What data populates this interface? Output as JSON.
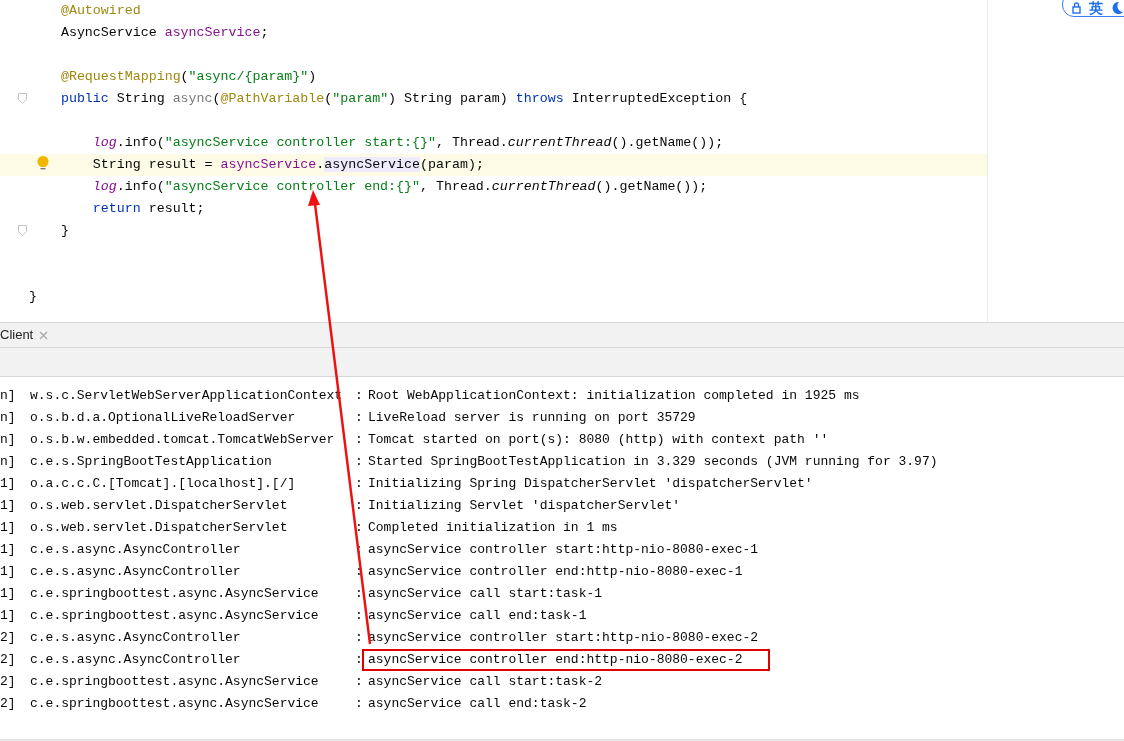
{
  "editor": {
    "lines": [
      {
        "kind": "code",
        "tokens": [
          {
            "text": "    @Autowired",
            "kind": "annotation"
          }
        ]
      },
      {
        "kind": "code",
        "tokens": [
          {
            "text": "    AsyncService ",
            "kind": "plain"
          },
          {
            "text": "asyncService",
            "kind": "field"
          },
          {
            "text": ";",
            "kind": "plain"
          }
        ]
      },
      {
        "kind": "blank"
      },
      {
        "kind": "code",
        "tokens": [
          {
            "text": "    @RequestMapping",
            "kind": "annotation"
          },
          {
            "text": "(",
            "kind": "plain"
          },
          {
            "text": "\"async/{param}\"",
            "kind": "string"
          },
          {
            "text": ")",
            "kind": "plain"
          }
        ]
      },
      {
        "kind": "code",
        "fold_marker": true,
        "tokens": [
          {
            "text": "    public",
            "kind": "keyword"
          },
          {
            "text": " String ",
            "kind": "plain"
          },
          {
            "text": "async",
            "kind": "unused"
          },
          {
            "text": "(",
            "kind": "plain"
          },
          {
            "text": "@PathVariable",
            "kind": "annotation"
          },
          {
            "text": "(",
            "kind": "plain"
          },
          {
            "text": "\"param\"",
            "kind": "string"
          },
          {
            "text": ") String param) ",
            "kind": "plain"
          },
          {
            "text": "throws",
            "kind": "keyword"
          },
          {
            "text": " InterruptedException {",
            "kind": "plain"
          }
        ]
      },
      {
        "kind": "blank"
      },
      {
        "kind": "code",
        "tokens": [
          {
            "text": "        log",
            "kind": "static-field"
          },
          {
            "text": ".info(",
            "kind": "plain"
          },
          {
            "text": "\"asyncService controller start:{}\"",
            "kind": "string"
          },
          {
            "text": ", Thread.",
            "kind": "plain"
          },
          {
            "text": "currentThread",
            "kind": "static-call"
          },
          {
            "text": "().getName());",
            "kind": "plain"
          }
        ]
      },
      {
        "kind": "code",
        "current": true,
        "intention_bulb": true,
        "tokens": [
          {
            "text": "        String result = ",
            "kind": "plain"
          },
          {
            "text": "asyncService",
            "kind": "field"
          },
          {
            "text": ".",
            "kind": "plain"
          },
          {
            "text": "asyncService",
            "kind": "usage"
          },
          {
            "text": "(param);",
            "kind": "plain"
          }
        ]
      },
      {
        "kind": "code",
        "tokens": [
          {
            "text": "        log",
            "kind": "static-field"
          },
          {
            "text": ".info(",
            "kind": "plain"
          },
          {
            "text": "\"asyncService controller end:{}\"",
            "kind": "string"
          },
          {
            "text": ", Thread.",
            "kind": "plain"
          },
          {
            "text": "currentThread",
            "kind": "static-call"
          },
          {
            "text": "().getName());",
            "kind": "plain"
          }
        ]
      },
      {
        "kind": "code",
        "tokens": [
          {
            "text": "        return",
            "kind": "keyword"
          },
          {
            "text": " result;",
            "kind": "plain"
          }
        ]
      },
      {
        "kind": "code",
        "fold_marker": true,
        "tokens": [
          {
            "text": "    }",
            "kind": "plain"
          }
        ]
      },
      {
        "kind": "blank"
      },
      {
        "kind": "blank"
      },
      {
        "kind": "code",
        "tokens": [
          {
            "text": "}",
            "kind": "plain"
          }
        ]
      }
    ]
  },
  "ime_indicator": {
    "label": "英"
  },
  "console": {
    "tabs": [
      {
        "label": "Client"
      }
    ],
    "lines": [
      {
        "thread": "n]",
        "logger": "w.s.c.ServletWebServerApplicationContext",
        "separator": ":",
        "message": "Root WebApplicationContext: initialization completed in 1925 ms"
      },
      {
        "thread": "n]",
        "logger": "o.s.b.d.a.OptionalLiveReloadServer",
        "separator": ":",
        "message": "LiveReload server is running on port 35729"
      },
      {
        "thread": "n]",
        "logger": "o.s.b.w.embedded.tomcat.TomcatWebServer",
        "separator": ":",
        "message": "Tomcat started on port(s): 8080 (http) with context path ''"
      },
      {
        "thread": "n]",
        "logger": "c.e.s.SpringBootTestApplication",
        "separator": ":",
        "message": "Started SpringBootTestApplication in 3.329 seconds (JVM running for 3.97)"
      },
      {
        "thread": "1]",
        "logger": "o.a.c.c.C.[Tomcat].[localhost].[/]",
        "separator": ":",
        "message": "Initializing Spring DispatcherServlet 'dispatcherServlet'"
      },
      {
        "thread": "1]",
        "logger": "o.s.web.servlet.DispatcherServlet",
        "separator": ":",
        "message": "Initializing Servlet 'dispatcherServlet'"
      },
      {
        "thread": "1]",
        "logger": "o.s.web.servlet.DispatcherServlet",
        "separator": ":",
        "message": "Completed initialization in 1 ms"
      },
      {
        "thread": "1]",
        "logger": "c.e.s.async.AsyncController",
        "separator": ":",
        "message": "asyncService controller start:http-nio-8080-exec-1"
      },
      {
        "thread": "1]",
        "logger": "c.e.s.async.AsyncController",
        "separator": ":",
        "message": "asyncService controller end:http-nio-8080-exec-1"
      },
      {
        "thread": "1]",
        "logger": "c.e.springboottest.async.AsyncService",
        "separator": ":",
        "message": "asyncService call start:task-1"
      },
      {
        "thread": "1]",
        "logger": "c.e.springboottest.async.AsyncService",
        "separator": ":",
        "message": "asyncService call end:task-1"
      },
      {
        "thread": "2]",
        "logger": "c.e.s.async.AsyncController",
        "separator": ":",
        "message": "asyncService controller start:http-nio-8080-exec-2"
      },
      {
        "thread": "2]",
        "logger": "c.e.s.async.AsyncController",
        "separator": ":",
        "message": "asyncService controller end:http-nio-8080-exec-2",
        "highlighted": true
      },
      {
        "thread": "2]",
        "logger": "c.e.springboottest.async.AsyncService",
        "separator": ":",
        "message": "asyncService call start:task-2"
      },
      {
        "thread": "2]",
        "logger": "c.e.springboottest.async.AsyncService",
        "separator": ":",
        "message": "asyncService call end:task-2"
      }
    ]
  },
  "annotation_arrow": true
}
